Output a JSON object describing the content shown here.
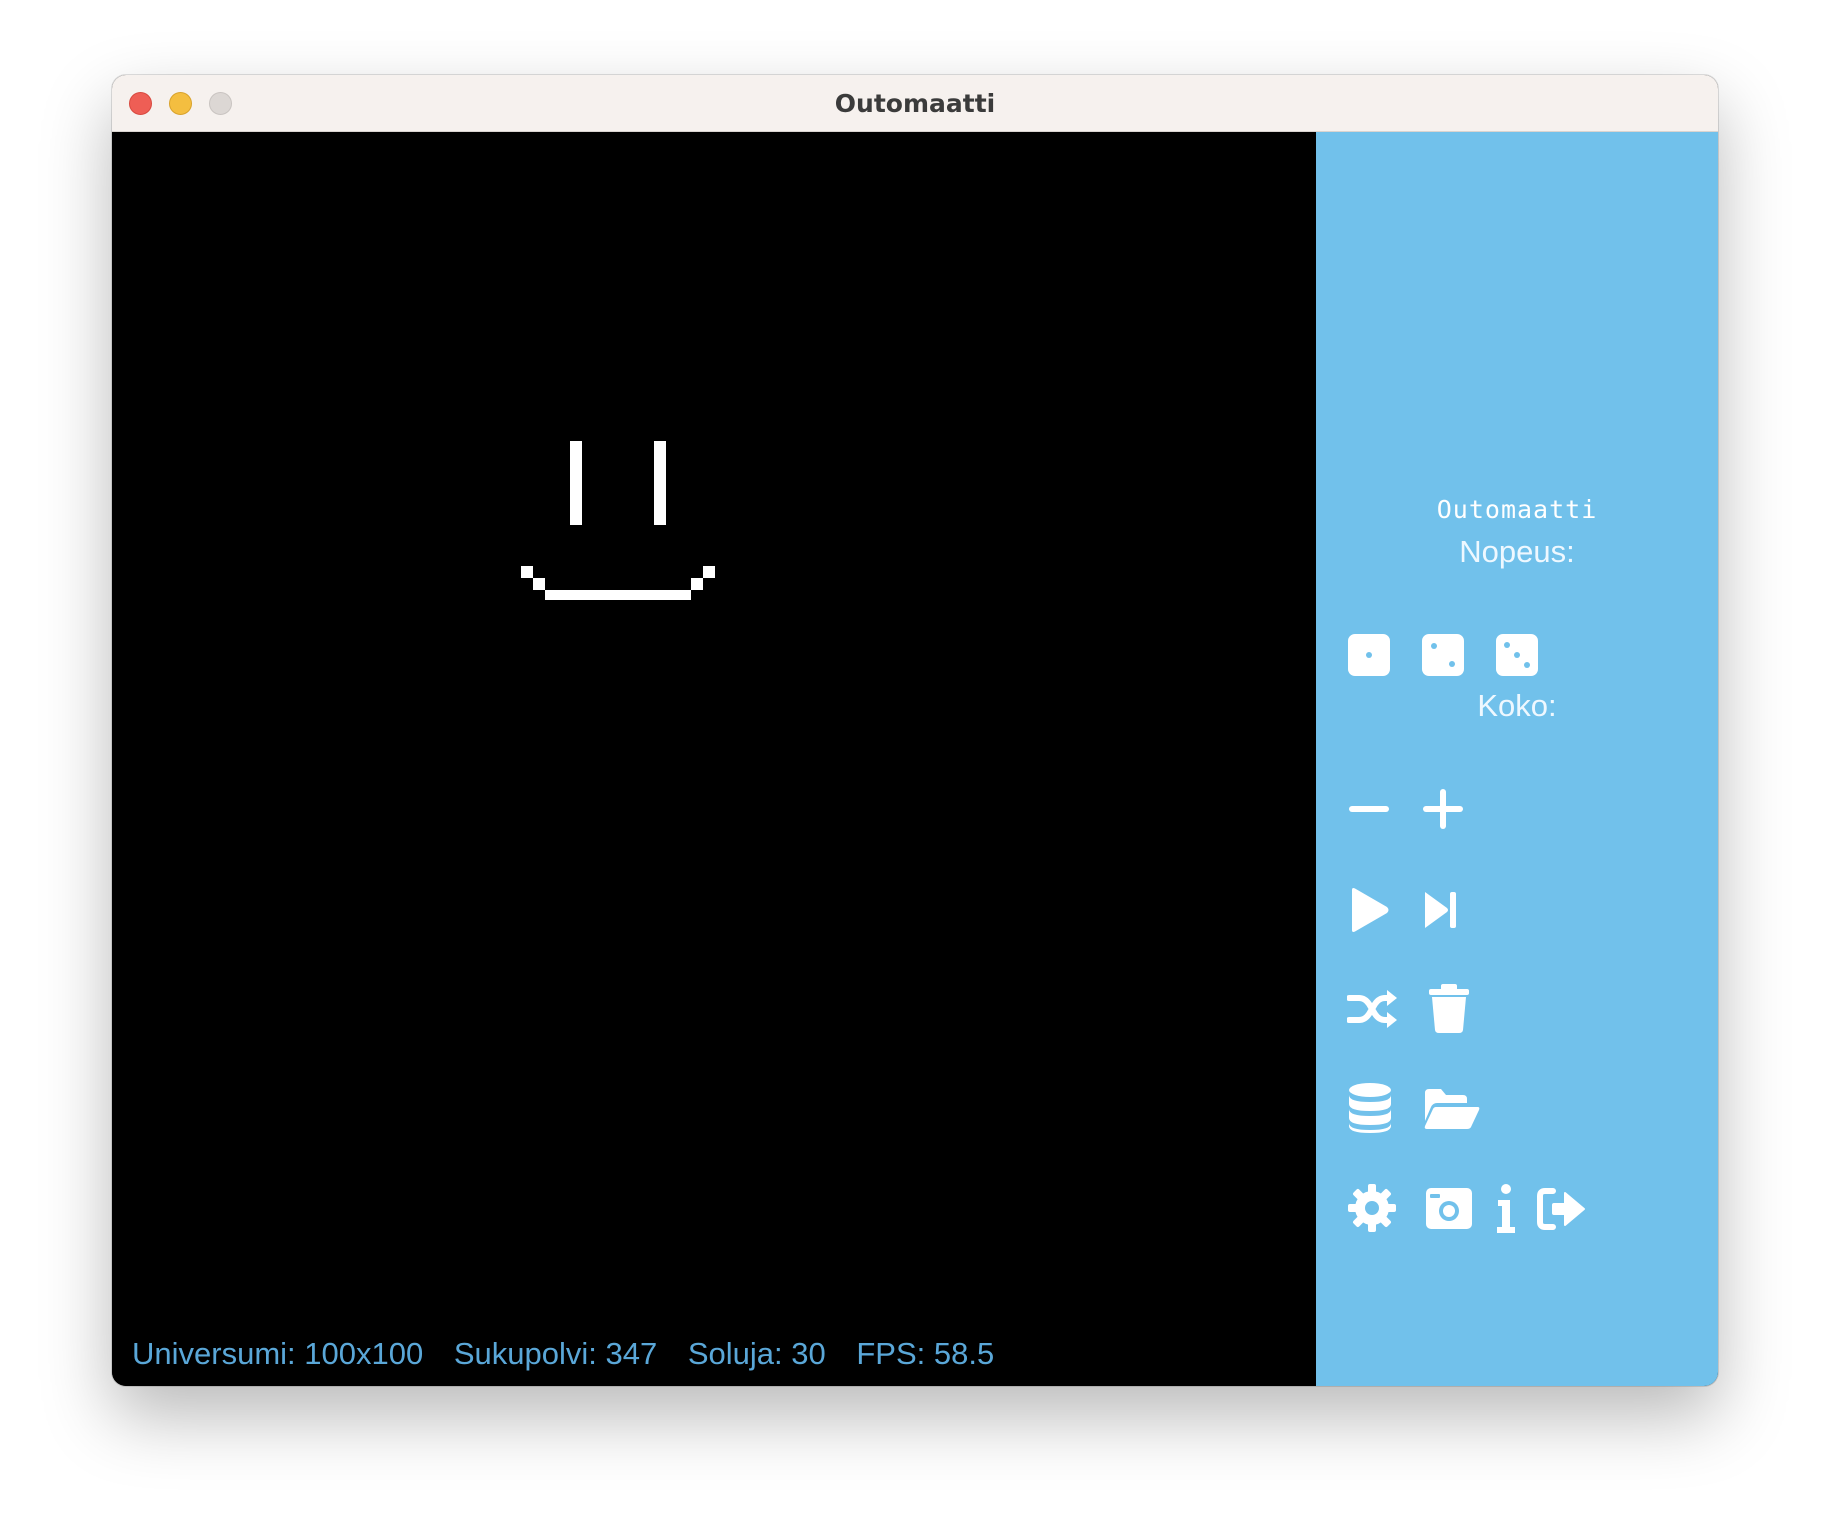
{
  "window": {
    "title": "Outomaatti"
  },
  "sidebar": {
    "title": "Outomaatti",
    "speed_label": "Nopeus:",
    "size_label": "Koko:",
    "icons": {
      "speed_slow": "die-one-icon",
      "speed_medium": "die-two-icon",
      "speed_fast": "die-three-icon",
      "size_decrease": "minus-icon",
      "size_increase": "plus-icon",
      "play": "play-icon",
      "step": "step-forward-icon",
      "randomize": "shuffle-icon",
      "clear": "trash-icon",
      "save": "database-icon",
      "open": "folder-open-icon",
      "settings": "gear-icon",
      "screenshot": "camera-icon",
      "info": "info-icon",
      "exit": "sign-out-icon"
    }
  },
  "status": {
    "universe": "Universumi: 100x100",
    "generation": "Sukupolvi: 347",
    "cells": "Soluja: 30",
    "fps": "FPS: 58.5"
  },
  "colors": {
    "canvas_bg": "#000000",
    "cell": "#ffffff",
    "sidebar_bg": "#71c1eb",
    "status_text": "#5aa7d8"
  }
}
